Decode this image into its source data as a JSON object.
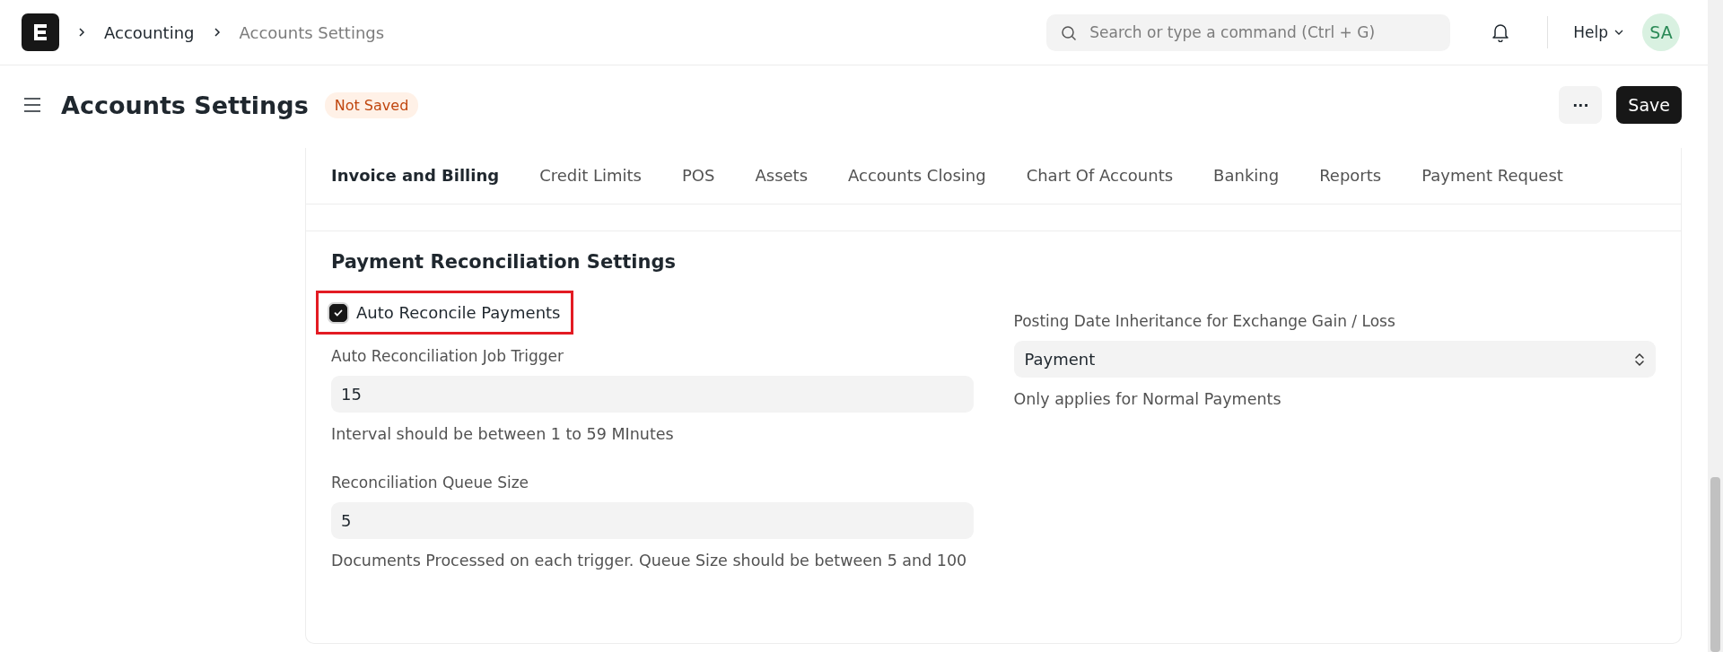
{
  "navbar": {
    "breadcrumbs": [
      {
        "label": "Accounting",
        "current": false
      },
      {
        "label": "Accounts Settings",
        "current": true
      }
    ],
    "search": {
      "placeholder": "Search or type a command (Ctrl + G)"
    },
    "help": "Help",
    "avatar": "SA"
  },
  "page_head": {
    "title": "Accounts Settings",
    "status": "Not Saved",
    "more": "···",
    "save": "Save"
  },
  "tabs": [
    {
      "label": "Invoice and Billing",
      "selected": true
    },
    {
      "label": "Credit Limits",
      "selected": false
    },
    {
      "label": "POS",
      "selected": false
    },
    {
      "label": "Assets",
      "selected": false
    },
    {
      "label": "Accounts Closing",
      "selected": false
    },
    {
      "label": "Chart Of Accounts",
      "selected": false
    },
    {
      "label": "Banking",
      "selected": false
    },
    {
      "label": "Reports",
      "selected": false
    },
    {
      "label": "Payment Request",
      "selected": false
    }
  ],
  "section": {
    "title": "Payment Reconciliation Settings",
    "left": [
      {
        "kind": "checkbox",
        "label": "Auto Reconcile Payments",
        "checked": true,
        "highlighted": true
      },
      {
        "kind": "input",
        "label": "Auto Reconciliation Job Trigger",
        "value": "15",
        "help": "Interval should be between 1 to 59 MInutes"
      },
      {
        "kind": "input",
        "label": "Reconciliation Queue Size",
        "value": "5",
        "help": "Documents Processed on each trigger. Queue Size should be between 5 and 100"
      }
    ],
    "right": [
      {
        "kind": "select",
        "label": "Posting Date Inheritance for Exchange Gain / Loss",
        "value": "Payment",
        "help": "Only applies for Normal Payments"
      }
    ]
  }
}
